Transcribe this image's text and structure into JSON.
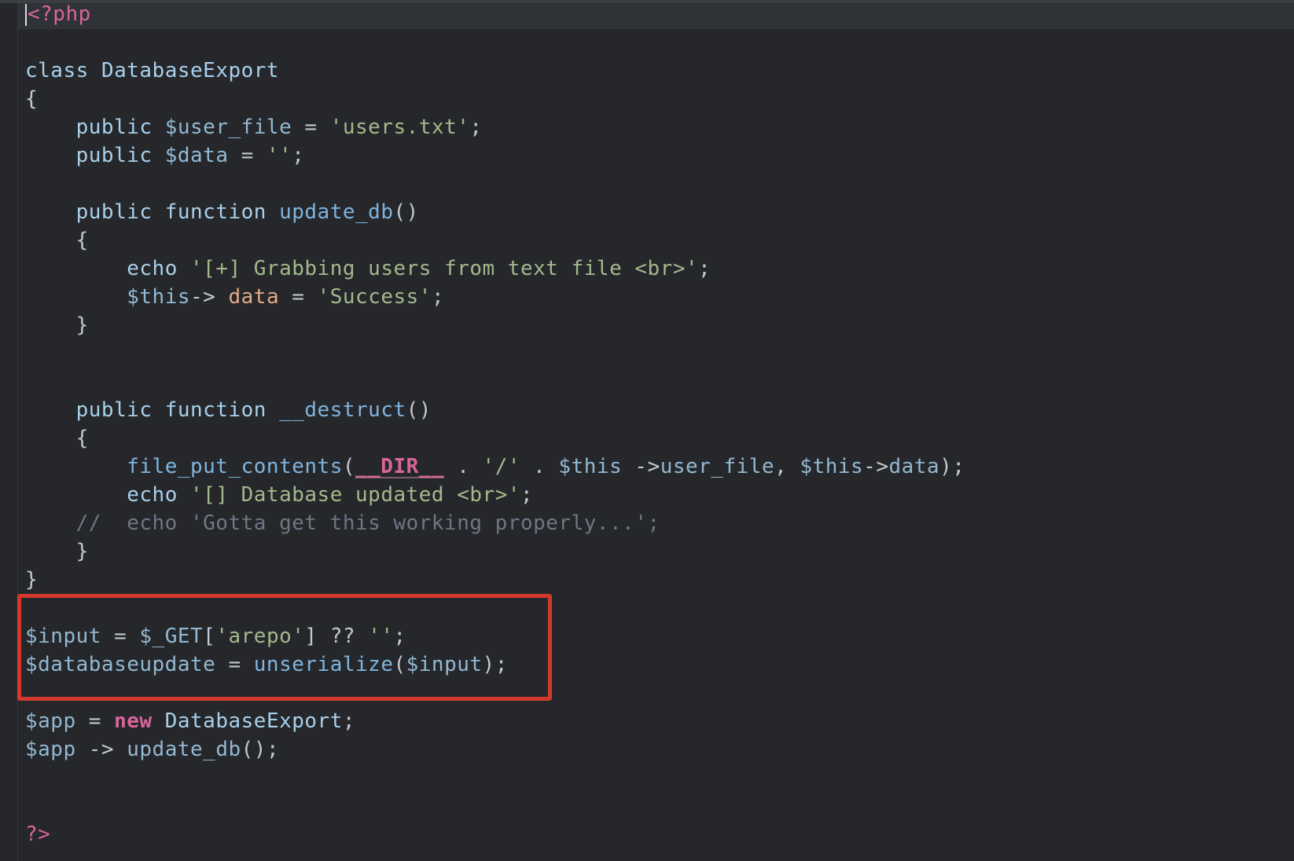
{
  "editor": {
    "language": "php",
    "lines": [
      "<?php",
      "",
      "class DatabaseExport",
      "{",
      "    public $user_file = 'users.txt';",
      "    public $data = '';",
      "",
      "    public function update_db()",
      "    {",
      "        echo '[+] Grabbing users from text file <br>';",
      "        $this-> data = 'Success';",
      "    }",
      "",
      "",
      "    public function __destruct()",
      "    {",
      "        file_put_contents(__DIR__ . '/' . $this ->user_file, $this->data);",
      "        echo '[] Database updated <br>';",
      "    //  echo 'Gotta get this working properly...';",
      "    }",
      "}",
      "",
      "$input = $_GET['arepo'] ?? '';",
      "$databaseupdate = unserialize($input);",
      "",
      "$app = new DatabaseExport;",
      "$app -> update_db();",
      "",
      "",
      "?>"
    ],
    "highlight": {
      "color": "#d2392c",
      "from_line": 22,
      "to_line": 23
    }
  }
}
